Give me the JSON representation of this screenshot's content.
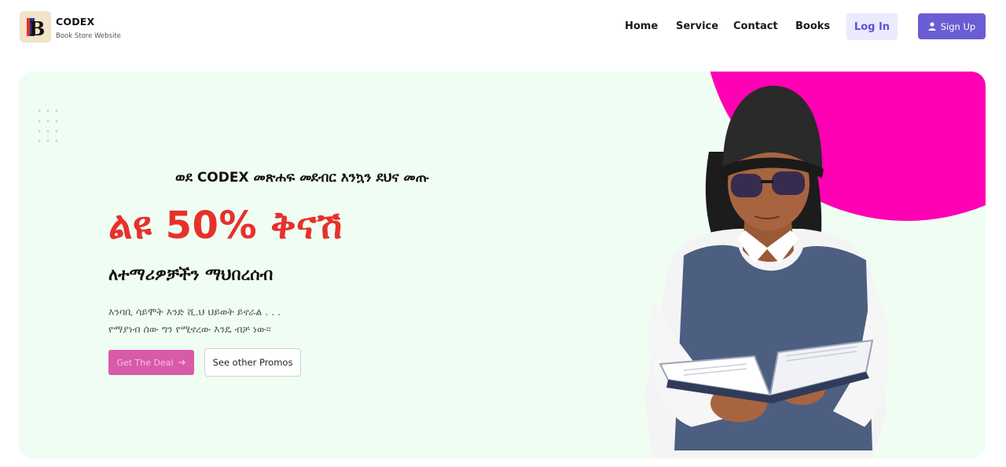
{
  "header": {
    "brand_name": "CODEX",
    "brand_tagline": "Book Store Website",
    "logo_letter": "B",
    "nav": [
      {
        "label": "Home"
      },
      {
        "label": "Service"
      },
      {
        "label": "Contact"
      },
      {
        "label": "Books"
      }
    ],
    "login_label": "Log In",
    "signup_label": "Sign Up"
  },
  "hero": {
    "welcome_text": "ወደ CODEX መጽሐፍ መደብር እንኳን ደህና መጡ",
    "headline": "ልዩ 50% ቅናሽ",
    "subheadline": "ለተማሪዎቻችን ማህበረሰብ",
    "description_lines": [
      "እንባቢ ሳይሞት እንድ ሺ.ህ ህይወት ይኖራል . . .",
      "የማያነብ ሰው ግን የሚኖረው እንዴ ብቻ ነው።"
    ],
    "cta_primary": "Get The Deal",
    "cta_primary_icon": "arrow-right-icon",
    "cta_secondary": "See other Promos"
  },
  "colors": {
    "accent": "#6b5dd3",
    "headline_red": "#e8302b",
    "hero_bg": "#effdf3",
    "circle_pink": "#ff00b4",
    "deal_button": "#d95aa8"
  }
}
